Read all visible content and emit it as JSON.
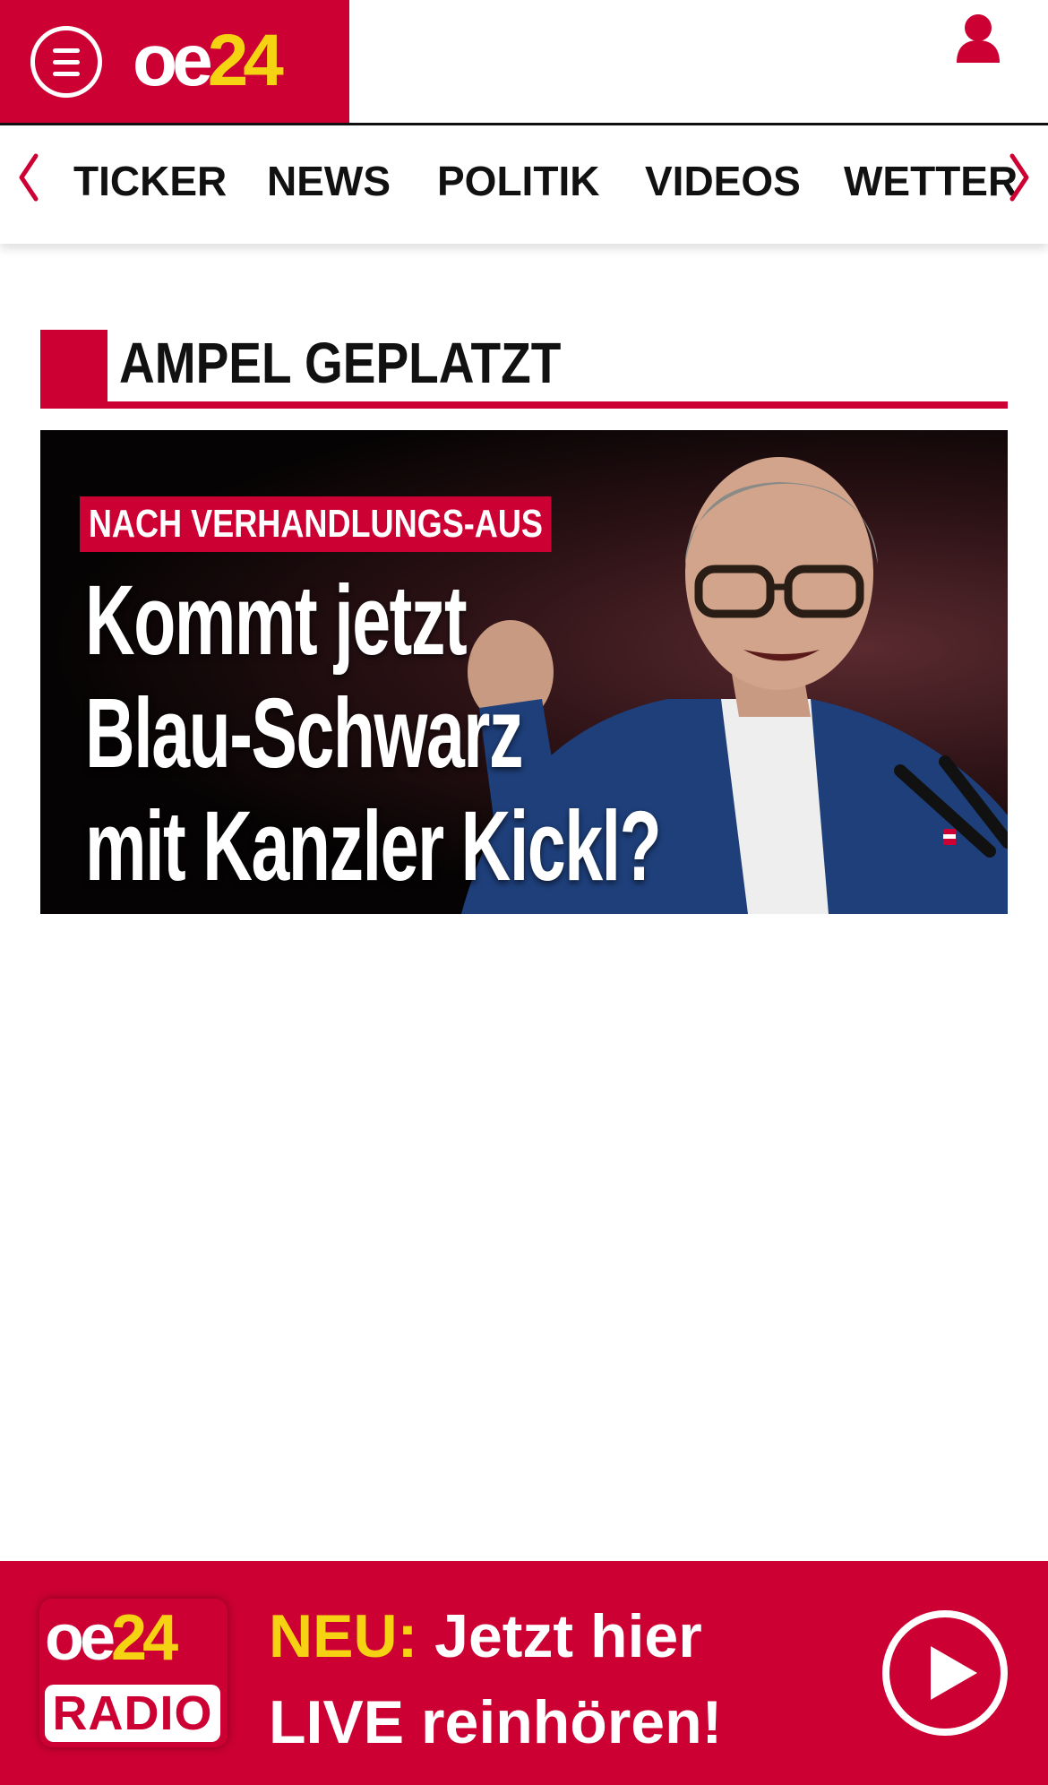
{
  "header": {
    "logo": {
      "oe": "oe",
      "num": "24"
    },
    "menu_icon": "hamburger-icon",
    "user_icon": "user-icon"
  },
  "nav": {
    "items": [
      "TICKER",
      "NEWS",
      "POLITIK",
      "VIDEOS",
      "WETTER"
    ],
    "prev_icon": "chevron-left-icon",
    "next_icon": "chevron-right-icon"
  },
  "section": {
    "title": "AMPEL GEPLATZT"
  },
  "hero": {
    "kicker": "NACH VERHANDLUNGS-AUS",
    "headline_lines": [
      "Kommt jetzt",
      "Blau-Schwarz",
      "mit Kanzler Kickl?"
    ]
  },
  "radio": {
    "logo_top_oe": "oe",
    "logo_top_num": "24",
    "logo_bottom": "RADIO",
    "neu_label": "NEU:",
    "line1": "Jetzt hier",
    "line2": "LIVE reinhören!",
    "play_icon": "play-icon"
  },
  "colors": {
    "brand_red": "#cc0033",
    "brand_yellow": "#f5d312",
    "text_dark": "#111111"
  }
}
